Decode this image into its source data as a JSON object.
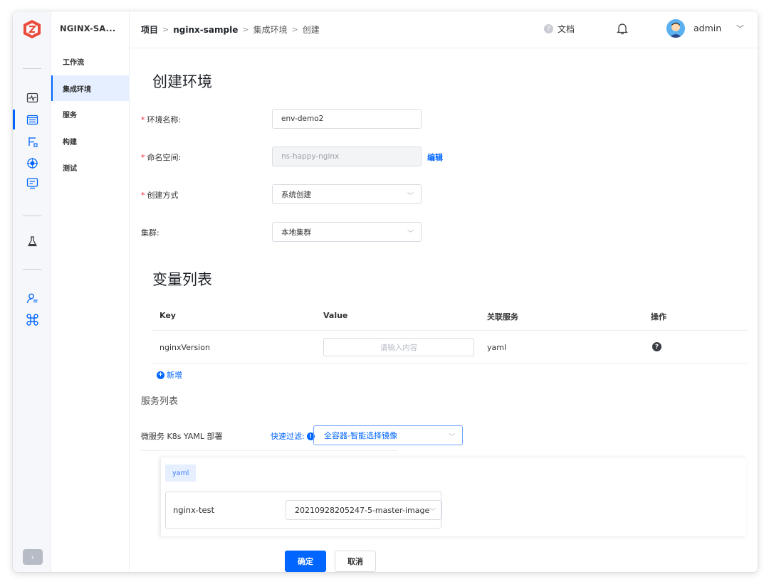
{
  "sidebar": {
    "project": "NGINX-SA...",
    "items": [
      {
        "label": "工作流"
      },
      {
        "label": "集成环境"
      },
      {
        "label": "服务"
      },
      {
        "label": "构建"
      },
      {
        "label": "测试"
      }
    ]
  },
  "header": {
    "breadcrumb": [
      "项目",
      "nginx-sample",
      "集成环境",
      "创建"
    ],
    "crumb_sep": ">",
    "docs": "文档",
    "user": "admin"
  },
  "form": {
    "title": "创建环境",
    "req_mark": "*",
    "env_name_label": "环境名称:",
    "env_name_value": "env-demo2",
    "namespace_label": "命名空间:",
    "namespace_value": "ns-happy-nginx",
    "edit_link": "编辑",
    "method_label": "创建方式",
    "method_value": "系统创建",
    "cluster_label": "集群:",
    "cluster_value": "本地集群"
  },
  "vars": {
    "title": "变量列表",
    "columns": [
      "Key",
      "Value",
      "关联服务",
      "操作"
    ],
    "rows": [
      {
        "key": "nginxVersion",
        "placeholder": "请输入内容",
        "service": "yaml",
        "action_icon": "?"
      }
    ],
    "add_label": "新增"
  },
  "services": {
    "title": "服务列表",
    "type_label": "微服务 K8s YAML 部署",
    "filter_label": "快速过滤:",
    "filter_value": "全容器-智能选择镜像",
    "tag": "yaml",
    "items": [
      {
        "name": "nginx-test",
        "image": "20210928205247-5-master-image"
      }
    ]
  },
  "actions": {
    "confirm": "确定",
    "cancel": "取消"
  },
  "colors": {
    "accent": "#0066ff",
    "required": "#f5222d"
  }
}
